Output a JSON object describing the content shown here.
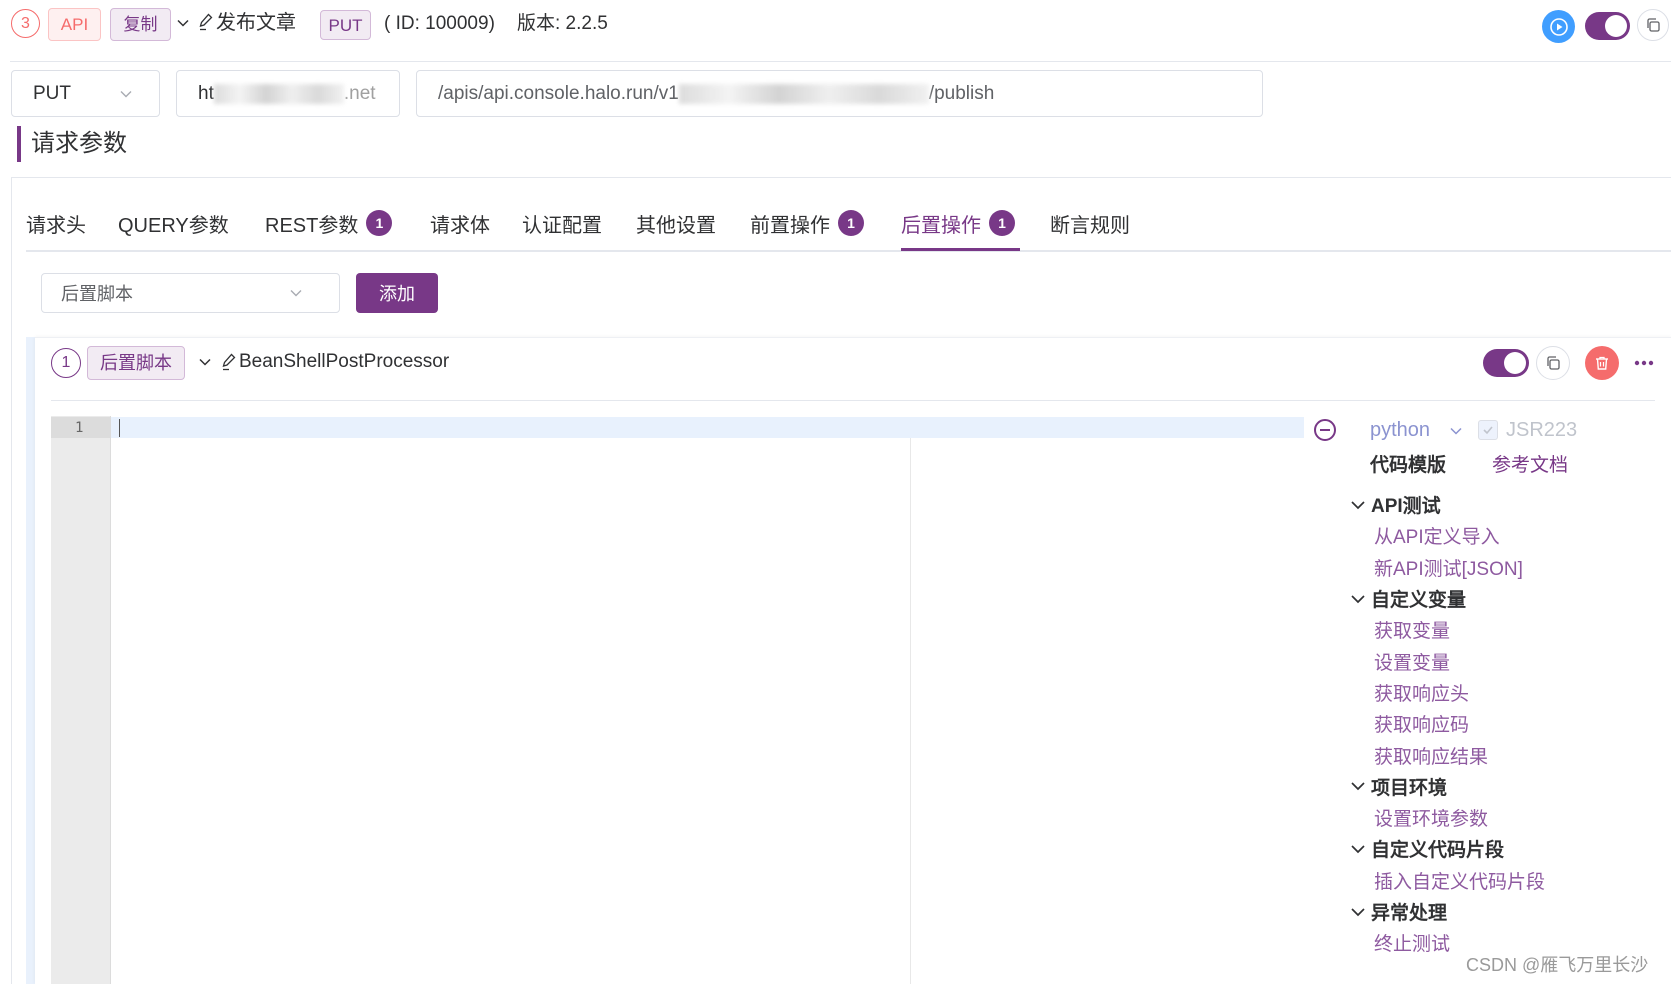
{
  "header": {
    "index": "3",
    "protocol_tag": "API",
    "copy_tag": "复制",
    "title": "发布文章",
    "method_tag": "PUT",
    "id_text": "( ID: 100009)",
    "version_text": "版本: 2.2.5",
    "enabled": true
  },
  "request": {
    "method": "PUT",
    "host_prefix": "ht",
    "host_suffix": ".net",
    "path_prefix": "/apis/api.console.halo.run/v1",
    "path_suffix": "/publish"
  },
  "section_title": "请求参数",
  "tabs": [
    {
      "label": "请求头"
    },
    {
      "label": "QUERY参数"
    },
    {
      "label": "REST参数",
      "badge": "1"
    },
    {
      "label": "请求体"
    },
    {
      "label": "认证配置"
    },
    {
      "label": "其他设置"
    },
    {
      "label": "前置操作",
      "badge": "1"
    },
    {
      "label": "后置操作",
      "badge": "1",
      "active": true
    },
    {
      "label": "断言规则"
    }
  ],
  "post_ops": {
    "type_select": "后置脚本",
    "add_label": "添加"
  },
  "processor": {
    "index": "1",
    "type_tag": "后置脚本",
    "name": "BeanShellPostProcessor",
    "enabled": true,
    "editor": {
      "line_numbers": [
        "1"
      ],
      "content": ""
    },
    "language": "python",
    "jsr223_label": "JSR223",
    "jsr223_checked": true,
    "template_title": "代码模版",
    "docs_link": "参考文档",
    "snippets": [
      {
        "group": "API测试",
        "items": [
          "从API定义导入",
          "新API测试[JSON]"
        ]
      },
      {
        "group": "自定义变量",
        "items": [
          "获取变量",
          "设置变量",
          "获取响应头",
          "获取响应码",
          "获取响应结果"
        ]
      },
      {
        "group": "项目环境",
        "items": [
          "设置环境参数"
        ]
      },
      {
        "group": "自定义代码片段",
        "items": [
          "插入自定义代码片段"
        ]
      },
      {
        "group": "异常处理",
        "items": [
          "终止测试"
        ]
      }
    ]
  },
  "watermark": "CSDN @雁飞万里长沙",
  "colors": {
    "accent": "#783887",
    "accent_bg": "#f2ebf3",
    "danger": "#f56c6c",
    "primary_blue": "#409eff",
    "link": "#8e5aa0",
    "language": "#8b93d0"
  }
}
